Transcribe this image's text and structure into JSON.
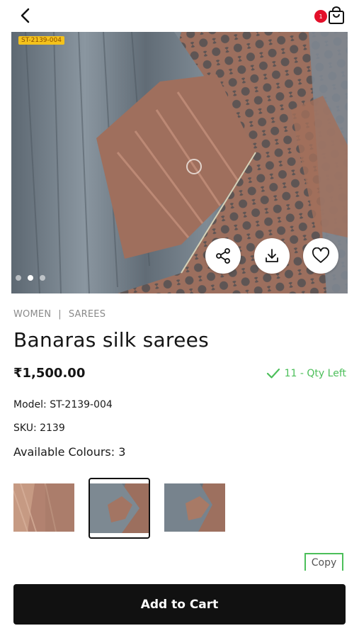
{
  "header": {
    "back_icon": "chevron-left-icon",
    "cart_icon": "shopping-bag-icon",
    "cart_count": "1"
  },
  "hero": {
    "sku_tag": "ST-2139-004",
    "image_count": 3,
    "active_image": 2,
    "actions": [
      {
        "name": "share",
        "icon": "share-icon"
      },
      {
        "name": "download",
        "icon": "download-icon"
      },
      {
        "name": "wishlist",
        "icon": "heart-icon"
      }
    ]
  },
  "product": {
    "category": "WOMEN",
    "subcategory": "SAREES",
    "title": "Banaras silk sarees",
    "price": "₹1,500.00",
    "stock": "11 - Qty Left",
    "model": "Model: ST-2139-004",
    "sku": "SKU: 2139",
    "colours": "Available Colours: 3"
  },
  "colour_swatches": [
    {
      "label": "peach",
      "selected": false
    },
    {
      "label": "grey-copper",
      "selected": true
    },
    {
      "label": "grey-copper-alt",
      "selected": false
    }
  ],
  "actions": {
    "copy": "Copy",
    "add_to_cart": "Add to Cart"
  },
  "colors": {
    "accent_green": "#4cbf5a",
    "badge_red": "#e3102a",
    "button_black": "#111111",
    "fabric_grey": "#6b7682",
    "fabric_copper": "#b07a62"
  }
}
